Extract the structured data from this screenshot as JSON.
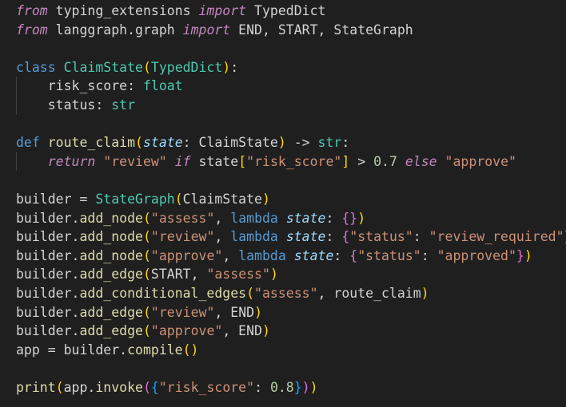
{
  "editor": {
    "theme_colors": {
      "background": "#1f1f1f",
      "keyword": "#569cd6",
      "control": "#c586c0",
      "class": "#4ec9b0",
      "function": "#dcdcaa",
      "variable": "#9cdcfe",
      "string": "#ce9178",
      "number": "#b5cea8",
      "bracket_1": "#ffd700",
      "bracket_2": "#da70d6",
      "bracket_3": "#179fff"
    },
    "lines": [
      {
        "indent": false,
        "tokens": [
          {
            "text": "from",
            "kind": "ctl"
          },
          {
            "text": " typing_extensions ",
            "kind": "plain"
          },
          {
            "text": "import",
            "kind": "ctl"
          },
          {
            "text": " TypedDict",
            "kind": "plain"
          }
        ]
      },
      {
        "indent": false,
        "tokens": [
          {
            "text": "from",
            "kind": "ctl"
          },
          {
            "text": " langgraph.graph ",
            "kind": "plain"
          },
          {
            "text": "import",
            "kind": "ctl"
          },
          {
            "text": " END, START, StateGraph",
            "kind": "plain"
          }
        ]
      },
      {
        "indent": false,
        "tokens": []
      },
      {
        "indent": false,
        "tokens": [
          {
            "text": "class",
            "kind": "kw"
          },
          {
            "text": " ",
            "kind": "plain"
          },
          {
            "text": "ClaimState",
            "kind": "cls"
          },
          {
            "text": "(",
            "kind": "b1"
          },
          {
            "text": "TypedDict",
            "kind": "cls"
          },
          {
            "text": ")",
            "kind": "b1"
          },
          {
            "text": ":",
            "kind": "plain"
          }
        ]
      },
      {
        "indent": true,
        "tokens": [
          {
            "text": "    risk_score",
            "kind": "plain"
          },
          {
            "text": ": ",
            "kind": "plain"
          },
          {
            "text": "float",
            "kind": "cls"
          }
        ]
      },
      {
        "indent": true,
        "tokens": [
          {
            "text": "    status",
            "kind": "plain"
          },
          {
            "text": ": ",
            "kind": "plain"
          },
          {
            "text": "str",
            "kind": "cls"
          }
        ]
      },
      {
        "indent": false,
        "tokens": []
      },
      {
        "indent": false,
        "tokens": [
          {
            "text": "def",
            "kind": "kw"
          },
          {
            "text": " ",
            "kind": "plain"
          },
          {
            "text": "route_claim",
            "kind": "fn"
          },
          {
            "text": "(",
            "kind": "b1"
          },
          {
            "text": "state",
            "kind": "prm"
          },
          {
            "text": ": ClaimState",
            "kind": "plain"
          },
          {
            "text": ")",
            "kind": "b1"
          },
          {
            "text": " -> ",
            "kind": "plain"
          },
          {
            "text": "str",
            "kind": "cls"
          },
          {
            "text": ":",
            "kind": "plain"
          }
        ]
      },
      {
        "indent": true,
        "tokens": [
          {
            "text": "    ",
            "kind": "plain"
          },
          {
            "text": "return",
            "kind": "ctl"
          },
          {
            "text": " ",
            "kind": "plain"
          },
          {
            "text": "\"review\"",
            "kind": "str"
          },
          {
            "text": " ",
            "kind": "plain"
          },
          {
            "text": "if",
            "kind": "ctl"
          },
          {
            "text": " state",
            "kind": "plain"
          },
          {
            "text": "[",
            "kind": "b1"
          },
          {
            "text": "\"risk_score\"",
            "kind": "str"
          },
          {
            "text": "]",
            "kind": "b1"
          },
          {
            "text": " > ",
            "kind": "plain"
          },
          {
            "text": "0.7",
            "kind": "num"
          },
          {
            "text": " ",
            "kind": "plain"
          },
          {
            "text": "else",
            "kind": "ctl"
          },
          {
            "text": " ",
            "kind": "plain"
          },
          {
            "text": "\"approve\"",
            "kind": "str"
          }
        ]
      },
      {
        "indent": false,
        "tokens": []
      },
      {
        "indent": false,
        "tokens": [
          {
            "text": "builder = ",
            "kind": "plain"
          },
          {
            "text": "StateGraph",
            "kind": "cls"
          },
          {
            "text": "(",
            "kind": "b1"
          },
          {
            "text": "ClaimState",
            "kind": "plain"
          },
          {
            "text": ")",
            "kind": "b1"
          }
        ]
      },
      {
        "indent": false,
        "tokens": [
          {
            "text": "builder.",
            "kind": "plain"
          },
          {
            "text": "add_node",
            "kind": "fn"
          },
          {
            "text": "(",
            "kind": "b1"
          },
          {
            "text": "\"assess\"",
            "kind": "str"
          },
          {
            "text": ", ",
            "kind": "plain"
          },
          {
            "text": "lambda",
            "kind": "kw"
          },
          {
            "text": " ",
            "kind": "plain"
          },
          {
            "text": "state",
            "kind": "prm"
          },
          {
            "text": ": ",
            "kind": "plain"
          },
          {
            "text": "{}",
            "kind": "b2"
          },
          {
            "text": ")",
            "kind": "b1"
          }
        ]
      },
      {
        "indent": false,
        "tokens": [
          {
            "text": "builder.",
            "kind": "plain"
          },
          {
            "text": "add_node",
            "kind": "fn"
          },
          {
            "text": "(",
            "kind": "b1"
          },
          {
            "text": "\"review\"",
            "kind": "str"
          },
          {
            "text": ", ",
            "kind": "plain"
          },
          {
            "text": "lambda",
            "kind": "kw"
          },
          {
            "text": " ",
            "kind": "plain"
          },
          {
            "text": "state",
            "kind": "prm"
          },
          {
            "text": ": ",
            "kind": "plain"
          },
          {
            "text": "{",
            "kind": "b2"
          },
          {
            "text": "\"status\"",
            "kind": "str"
          },
          {
            "text": ": ",
            "kind": "plain"
          },
          {
            "text": "\"review_required\"",
            "kind": "str"
          },
          {
            "text": "}",
            "kind": "b2"
          },
          {
            "text": ")",
            "kind": "b1"
          }
        ]
      },
      {
        "indent": false,
        "tokens": [
          {
            "text": "builder.",
            "kind": "plain"
          },
          {
            "text": "add_node",
            "kind": "fn"
          },
          {
            "text": "(",
            "kind": "b1"
          },
          {
            "text": "\"approve\"",
            "kind": "str"
          },
          {
            "text": ", ",
            "kind": "plain"
          },
          {
            "text": "lambda",
            "kind": "kw"
          },
          {
            "text": " ",
            "kind": "plain"
          },
          {
            "text": "state",
            "kind": "prm"
          },
          {
            "text": ": ",
            "kind": "plain"
          },
          {
            "text": "{",
            "kind": "b2"
          },
          {
            "text": "\"status\"",
            "kind": "str"
          },
          {
            "text": ": ",
            "kind": "plain"
          },
          {
            "text": "\"approved\"",
            "kind": "str"
          },
          {
            "text": "}",
            "kind": "b2"
          },
          {
            "text": ")",
            "kind": "b1"
          }
        ]
      },
      {
        "indent": false,
        "tokens": [
          {
            "text": "builder.",
            "kind": "plain"
          },
          {
            "text": "add_edge",
            "kind": "fn"
          },
          {
            "text": "(",
            "kind": "b1"
          },
          {
            "text": "START, ",
            "kind": "plain"
          },
          {
            "text": "\"assess\"",
            "kind": "str"
          },
          {
            "text": ")",
            "kind": "b1"
          }
        ]
      },
      {
        "indent": false,
        "tokens": [
          {
            "text": "builder.",
            "kind": "plain"
          },
          {
            "text": "add_conditional_edges",
            "kind": "fn"
          },
          {
            "text": "(",
            "kind": "b1"
          },
          {
            "text": "\"assess\"",
            "kind": "str"
          },
          {
            "text": ", route_claim",
            "kind": "plain"
          },
          {
            "text": ")",
            "kind": "b1"
          }
        ]
      },
      {
        "indent": false,
        "tokens": [
          {
            "text": "builder.",
            "kind": "plain"
          },
          {
            "text": "add_edge",
            "kind": "fn"
          },
          {
            "text": "(",
            "kind": "b1"
          },
          {
            "text": "\"review\"",
            "kind": "str"
          },
          {
            "text": ", END",
            "kind": "plain"
          },
          {
            "text": ")",
            "kind": "b1"
          }
        ]
      },
      {
        "indent": false,
        "tokens": [
          {
            "text": "builder.",
            "kind": "plain"
          },
          {
            "text": "add_edge",
            "kind": "fn"
          },
          {
            "text": "(",
            "kind": "b1"
          },
          {
            "text": "\"approve\"",
            "kind": "str"
          },
          {
            "text": ", END",
            "kind": "plain"
          },
          {
            "text": ")",
            "kind": "b1"
          }
        ]
      },
      {
        "indent": false,
        "tokens": [
          {
            "text": "app = builder.",
            "kind": "plain"
          },
          {
            "text": "compile",
            "kind": "fn"
          },
          {
            "text": "()",
            "kind": "b1"
          }
        ]
      },
      {
        "indent": false,
        "tokens": []
      },
      {
        "indent": false,
        "tokens": [
          {
            "text": "print",
            "kind": "fn"
          },
          {
            "text": "(",
            "kind": "b1"
          },
          {
            "text": "app.",
            "kind": "plain"
          },
          {
            "text": "invoke",
            "kind": "fn"
          },
          {
            "text": "(",
            "kind": "b2"
          },
          {
            "text": "{",
            "kind": "b3"
          },
          {
            "text": "\"risk_score\"",
            "kind": "str"
          },
          {
            "text": ": ",
            "kind": "plain"
          },
          {
            "text": "0.8",
            "kind": "num"
          },
          {
            "text": "}",
            "kind": "b3"
          },
          {
            "text": ")",
            "kind": "b2"
          },
          {
            "text": ")",
            "kind": "b1"
          }
        ]
      }
    ]
  }
}
